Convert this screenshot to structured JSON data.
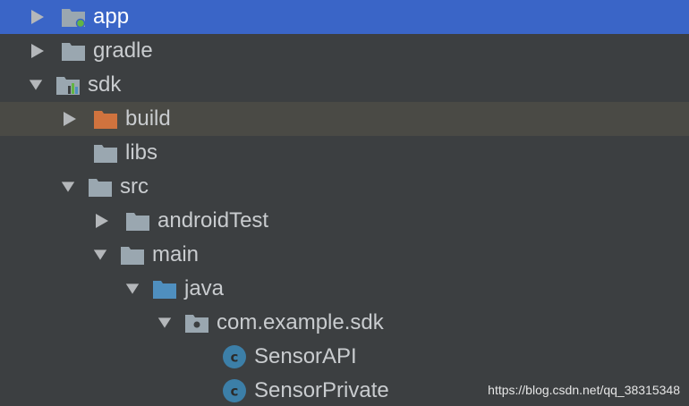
{
  "tree": {
    "rows": [
      {
        "label": "app",
        "icon": "module-folder-icon",
        "expander": "collapsed",
        "state": "selected"
      },
      {
        "label": "gradle",
        "icon": "folder-icon",
        "expander": "collapsed"
      },
      {
        "label": "sdk",
        "icon": "module-folder-icon",
        "expander": "expanded"
      },
      {
        "label": "build",
        "icon": "excluded-folder-icon",
        "expander": "collapsed",
        "state": "hover"
      },
      {
        "label": "libs",
        "icon": "folder-icon",
        "expander": "none"
      },
      {
        "label": "src",
        "icon": "folder-icon",
        "expander": "expanded"
      },
      {
        "label": "androidTest",
        "icon": "folder-icon",
        "expander": "collapsed"
      },
      {
        "label": "main",
        "icon": "folder-icon",
        "expander": "expanded"
      },
      {
        "label": "java",
        "icon": "source-folder-icon",
        "expander": "expanded"
      },
      {
        "label": "com.example.sdk",
        "icon": "package-icon",
        "expander": "expanded"
      },
      {
        "label": "SensorAPI",
        "icon": "class-icon",
        "expander": "none"
      },
      {
        "label": "SensorPrivate",
        "icon": "class-icon",
        "expander": "none"
      }
    ]
  },
  "watermark": "https://blog.csdn.net/qq_38315348",
  "colors": {
    "background": "#3c3f41",
    "selection": "#3a65c7",
    "hover": "#4a4a45",
    "text": "#c9cccf",
    "folder": "#9aa7b0",
    "excluded_folder": "#d0733e",
    "source_folder": "#4f8fbf",
    "class_circle": "#3c7fa8"
  }
}
